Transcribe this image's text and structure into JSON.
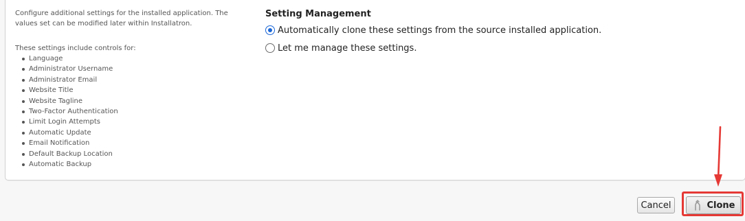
{
  "description": {
    "intro": "Configure additional settings for the installed application. The values set can be modified later within Installatron.",
    "list_heading": "These settings include controls for:",
    "items": [
      "Language",
      "Administrator Username",
      "Administrator Email",
      "Website Title",
      "Website Tagline",
      "Two-Factor Authentication",
      "Limit Login Attempts",
      "Automatic Update",
      "Email Notification",
      "Default Backup Location",
      "Automatic Backup"
    ]
  },
  "setting_management": {
    "title": "Setting Management",
    "options": [
      {
        "label": "Automatically clone these settings from the source installed application.",
        "selected": true
      },
      {
        "label": "Let me manage these settings.",
        "selected": false
      }
    ]
  },
  "actions": {
    "cancel_label": "Cancel",
    "clone_label": "Clone"
  },
  "colors": {
    "annotation": "#e53935",
    "radio_accent": "#1a66d6"
  }
}
